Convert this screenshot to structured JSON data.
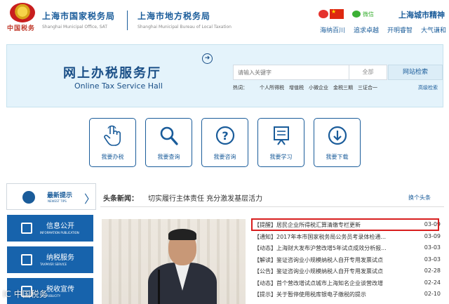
{
  "header": {
    "emblem_text": "中国税务",
    "org1_cn": "上海市国家税务局",
    "org1_en": "Shanghai Municipal Office, SAT",
    "org2_cn": "上海市地方税务局",
    "org2_en": "Shanghai Municipal Bureau of Local Taxation",
    "wechat": "微信",
    "city_spirit": "上海城市精神",
    "spirit_words": [
      "海纳百川",
      "追求卓越",
      "开明睿智",
      "大气谦和"
    ]
  },
  "hall": {
    "title_cn": "网上办税服务厅",
    "title_en": "Online Tax Service Hall",
    "search_placeholder": "请输入关键字",
    "scope": "全部",
    "search_button": "网站检索",
    "hot_label": "热词：",
    "hot_keywords": [
      "个人所得税",
      "增值税",
      "小微企业",
      "金税三期",
      "三证合一"
    ],
    "advanced_search": "高级检索"
  },
  "quick_buttons": [
    "我要办税",
    "我要查询",
    "我要咨询",
    "我要学习",
    "我要下载"
  ],
  "left_nav": {
    "tips_cn": "最新提示",
    "tips_en": "NEWEST TIPS",
    "items": [
      {
        "cn": "信息公开",
        "en": "INFORMATION PUBLICATION"
      },
      {
        "cn": "纳税服务",
        "en": "TAXPAYER SERVICE"
      },
      {
        "cn": "税收宣传",
        "en": "TAX PUBLICITY"
      }
    ]
  },
  "news": {
    "label": "头条新闻：",
    "headline": "切实履行主体责任  充分激发基层活力",
    "more": "换个头条",
    "items": [
      {
        "title": "【提醒】居民企业所得税汇算清缴专栏更新",
        "date": "03-09"
      },
      {
        "title": "【通知】2017年本市国家税务局公务员考录体检通...",
        "date": "03-09"
      },
      {
        "title": "【动态】上海财大发布沪营改增5年试点成效分析报...",
        "date": "03-03"
      },
      {
        "title": "【解读】鉴证咨询业小规模纳税人自开专用发票试点",
        "date": "03-03"
      },
      {
        "title": "【公告】鉴证咨询业小规模纳税人自开专用发票试点",
        "date": "02-28"
      },
      {
        "title": "【动态】首个营改增试点城市上海知名企业谈营改增",
        "date": "02-24"
      },
      {
        "title": "【提示】关于暂停使用税库银电子缴税的提示",
        "date": "02-10"
      }
    ]
  },
  "watermark": "IC 中国税务"
}
